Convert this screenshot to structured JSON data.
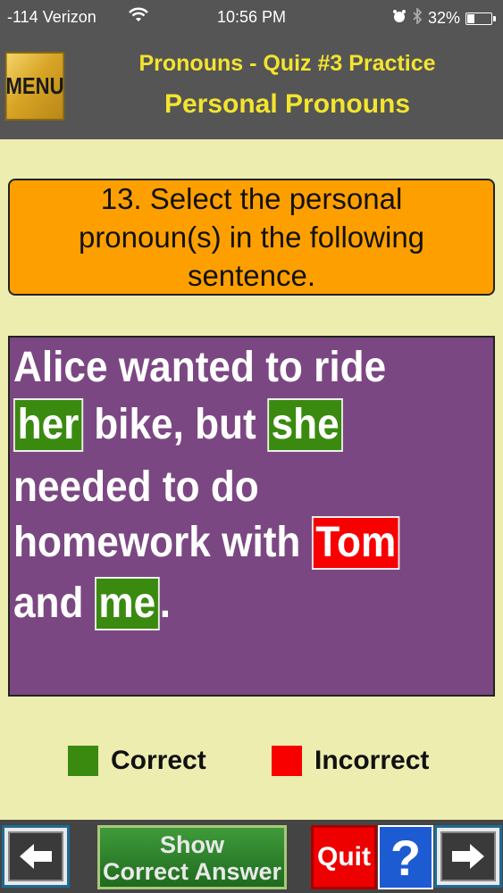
{
  "status_bar": {
    "carrier": "-114 Verizon",
    "time": "10:56 PM",
    "battery": "32%",
    "battery_level": 0.32
  },
  "header": {
    "menu_label": "MENU",
    "title": "Pronouns - Quiz #3 Practice",
    "subtitle": "Personal Pronouns"
  },
  "question": {
    "text": "13. Select the personal pronoun(s) in the following sentence."
  },
  "sentence": {
    "line1": "Alice wanted to ride",
    "line2_w1": "her",
    "line2_mid": " bike, but ",
    "line2_w2": "she",
    "line3": "needed to do",
    "line4_pre": "homework with ",
    "line4_w": "Tom",
    "line5_pre": "and ",
    "line5_w": "me",
    "line5_post": "."
  },
  "legend": {
    "correct_label": "Correct",
    "incorrect_label": "Incorrect",
    "correct_color": "#3a8a10",
    "incorrect_color": "#f80000"
  },
  "bottom_bar": {
    "show_line1": "Show",
    "show_line2": "Correct Answer",
    "quit_label": "Quit",
    "help_label": "?",
    "back_icon": "left-arrow-icon",
    "next_icon": "right-arrow-icon"
  }
}
